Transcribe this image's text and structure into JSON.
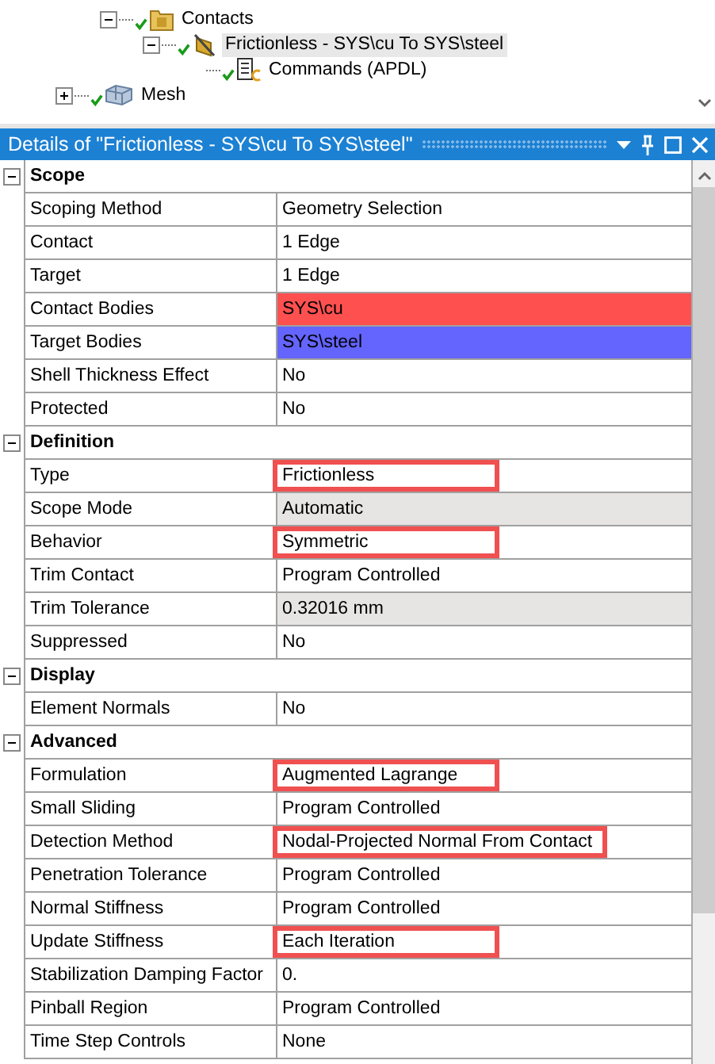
{
  "tree": {
    "items": [
      {
        "children": [
          {
            "label": "Contacts",
            "kind": "folder",
            "checked": true,
            "expanded": true,
            "selected": false,
            "children": [
              {
                "label": "Frictionless - SYS\\cu To SYS\\steel",
                "kind": "contact",
                "checked": true,
                "expanded": true,
                "selected": true,
                "children": [
                  {
                    "label": "Commands (APDL)",
                    "kind": "commands",
                    "checked": true,
                    "selected": false
                  }
                ]
              }
            ]
          }
        ]
      },
      {
        "label": "Mesh",
        "kind": "mesh",
        "checked": true,
        "expanded": false,
        "selected": false
      }
    ]
  },
  "details": {
    "title": "Details of \"Frictionless - SYS\\cu To SYS\\steel\"",
    "sections": [
      {
        "title": "Scope",
        "expanded": true,
        "rows": [
          {
            "label": "Scoping Method",
            "value": "Geometry Selection",
            "readonly": false,
            "highlighted": false
          },
          {
            "label": "Contact",
            "value": "1 Edge",
            "readonly": false,
            "highlighted": false
          },
          {
            "label": "Target",
            "value": "1 Edge",
            "readonly": false,
            "highlighted": false
          },
          {
            "label": "Contact Bodies",
            "value": "SYS\\cu",
            "readonly": false,
            "highlighted": false,
            "color": "#ff5050"
          },
          {
            "label": "Target Bodies",
            "value": "SYS\\steel",
            "readonly": false,
            "highlighted": false,
            "color": "#6464ff"
          },
          {
            "label": "Shell Thickness Effect",
            "value": "No",
            "readonly": false,
            "highlighted": false
          },
          {
            "label": "Protected",
            "value": "No",
            "readonly": false,
            "highlighted": false
          }
        ]
      },
      {
        "title": "Definition",
        "expanded": true,
        "rows": [
          {
            "label": "Type",
            "value": "Frictionless",
            "readonly": false,
            "highlighted": true
          },
          {
            "label": "Scope Mode",
            "value": "Automatic",
            "readonly": true,
            "highlighted": false
          },
          {
            "label": "Behavior",
            "value": "Symmetric",
            "readonly": false,
            "highlighted": true
          },
          {
            "label": "Trim Contact",
            "value": "Program Controlled",
            "readonly": false,
            "highlighted": false
          },
          {
            "label": "Trim Tolerance",
            "value": "0.32016 mm",
            "readonly": true,
            "highlighted": false
          },
          {
            "label": "Suppressed",
            "value": "No",
            "readonly": false,
            "highlighted": false
          }
        ]
      },
      {
        "title": "Display",
        "expanded": true,
        "rows": [
          {
            "label": "Element Normals",
            "value": "No",
            "readonly": false,
            "highlighted": false
          }
        ]
      },
      {
        "title": "Advanced",
        "expanded": true,
        "rows": [
          {
            "label": "Formulation",
            "value": "Augmented Lagrange",
            "readonly": false,
            "highlighted": true
          },
          {
            "label": "Small Sliding",
            "value": "Program Controlled",
            "readonly": false,
            "highlighted": false
          },
          {
            "label": "Detection Method",
            "value": "Nodal-Projected Normal From Contact",
            "readonly": false,
            "highlighted": true
          },
          {
            "label": "Penetration Tolerance",
            "value": "Program Controlled",
            "readonly": false,
            "highlighted": false
          },
          {
            "label": "Normal Stiffness",
            "value": "Program Controlled",
            "readonly": false,
            "highlighted": false
          },
          {
            "label": "Update Stiffness",
            "value": "Each Iteration",
            "readonly": false,
            "highlighted": true
          },
          {
            "label": "Stabilization Damping Factor",
            "value": "0.",
            "readonly": false,
            "highlighted": false
          },
          {
            "label": "Pinball Region",
            "value": "Program Controlled",
            "readonly": false,
            "highlighted": false
          },
          {
            "label": "Time Step Controls",
            "value": "None",
            "readonly": false,
            "highlighted": false
          }
        ]
      }
    ]
  }
}
